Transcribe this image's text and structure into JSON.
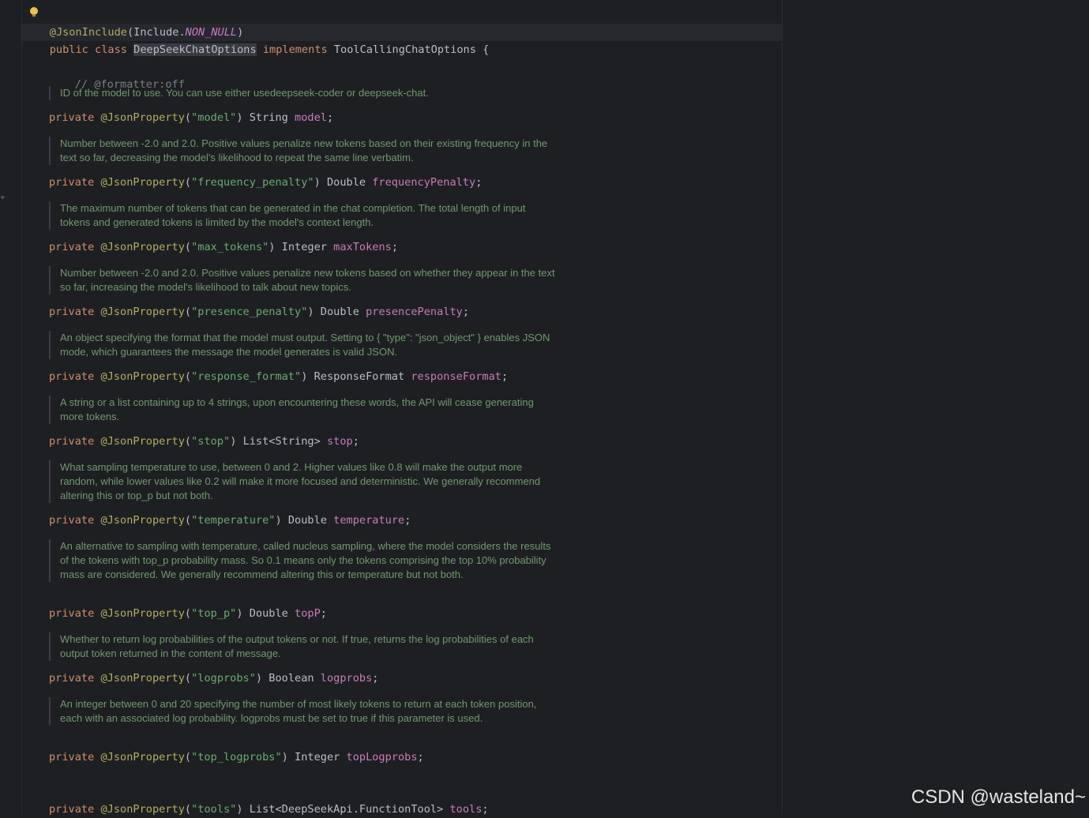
{
  "code": {
    "annotation_line": {
      "at": "@",
      "name": "JsonInclude",
      "open": "(Include.",
      "constant": "NON_NULL",
      "close": ")"
    },
    "class_line": {
      "public": "public",
      "class": "class",
      "name": "DeepSeekChatOptions",
      "implements": "implements",
      "iface": "ToolCallingChatOptions",
      "brace": "{"
    },
    "formatter_comment": "// @formatter:off",
    "private_kw": "private",
    "json_ann": "@JsonProperty",
    "fields": [
      {
        "doc": "ID of the model to use. You can use either usedeepseek-coder or deepseek-chat.",
        "key": "\"model\"",
        "type": "String",
        "name": "model"
      },
      {
        "doc": "Number between -2.0 and 2.0. Positive values penalize new tokens based on their existing frequency in the text so far, decreasing the model's likelihood to repeat the same line verbatim.",
        "key": "\"frequency_penalty\"",
        "type": "Double",
        "name": "frequencyPenalty"
      },
      {
        "doc": "The maximum number of tokens that can be generated in the chat completion. The total length of input tokens and generated tokens is limited by the model's context length.",
        "key": "\"max_tokens\"",
        "type": "Integer",
        "name": "maxTokens"
      },
      {
        "doc": "Number between -2.0 and 2.0. Positive values penalize new tokens based on whether they appear in the text so far, increasing the model's likelihood to talk about new topics.",
        "key": "\"presence_penalty\"",
        "type": "Double",
        "name": "presencePenalty"
      },
      {
        "doc": "An object specifying the format that the model must output. Setting to { \"type\": \"json_object\" } enables JSON mode, which guarantees the message the model generates is valid JSON.",
        "key": "\"response_format\"",
        "type": "ResponseFormat",
        "name": "responseFormat"
      },
      {
        "doc": "A string or a list containing up to 4 strings, upon encountering these words, the API will cease generating more tokens.",
        "key": "\"stop\"",
        "type": "List<String>",
        "name": "stop"
      },
      {
        "doc": "What sampling temperature to use, between 0 and 2. Higher values like 0.8 will make the output more random, while lower values like 0.2 will make it more focused and deterministic. We generally recommend altering this or top_p but not both.",
        "key": "\"temperature\"",
        "type": "Double",
        "name": "temperature"
      },
      {
        "doc": "An alternative to sampling with temperature, called nucleus sampling, where the model considers the results of the tokens with top_p probability mass. So 0.1 means only the tokens comprising the top 10% probability mass are considered. We generally recommend altering this or temperature but not both.",
        "key": "\"top_p\"",
        "type": "Double",
        "name": "topP"
      },
      {
        "doc": "Whether to return log probabilities of the output tokens or not. If true, returns the log probabilities of each output token returned in the content of message.",
        "key": "\"logprobs\"",
        "type": "Boolean",
        "name": "logprobs"
      },
      {
        "doc": "An integer between 0 and 20 specifying the number of most likely tokens to return at each token position, each with an associated log probability. logprobs must be set to true if this parameter is used.",
        "key": "\"top_logprobs\"",
        "type": "Integer",
        "name": "topLogprobs"
      },
      {
        "key": "\"tools\"",
        "type": "List<DeepSeekApi.FunctionTool>",
        "name": "tools"
      }
    ]
  },
  "watermark": "CSDN @wasteland~",
  "gutter_icon": "bookmark-icon"
}
